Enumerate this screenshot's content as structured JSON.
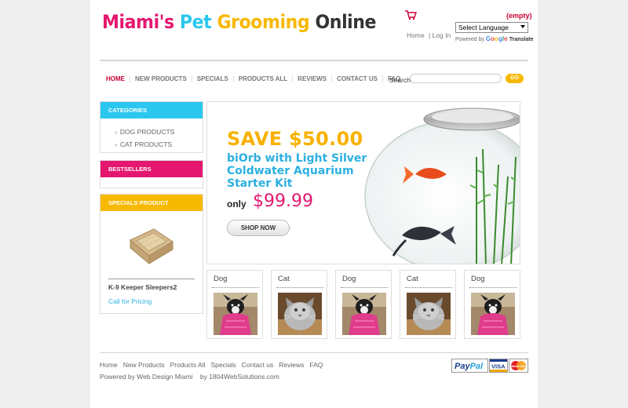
{
  "logo": {
    "parts": [
      {
        "text": "Miami's ",
        "color": "#e5176f"
      },
      {
        "text": "Pet ",
        "color": "#2bc7ee"
      },
      {
        "text": "Grooming ",
        "color": "#f7b800"
      },
      {
        "text": "Online",
        "color": "#333333"
      }
    ]
  },
  "header": {
    "cart_status": "(empty)",
    "language_select": "Select Language",
    "home_link": "Home",
    "login_link": "| Log In",
    "powered_by": "Powered by",
    "google": "Google",
    "translate": "Translate"
  },
  "nav": {
    "items": [
      "HOME",
      "NEW PRODUCTS",
      "SPECIALS",
      "PRODUCTS ALL",
      "REVIEWS",
      "CONTACT US",
      "FAQ"
    ],
    "search_label": "Search",
    "search_button": "GO"
  },
  "sidebar": {
    "categories_title": "CATEGORIES",
    "categories": [
      "DOG PRODUCTS",
      "CAT PRODUCTS"
    ],
    "bestsellers_title": "BESTSELLERS",
    "specials_title": "SPECIALS PRODUCT",
    "special_name": "K-9 Keeper Sleepers2",
    "special_price": "Call for Pricing"
  },
  "banner": {
    "save": "SAVE $50.00",
    "description": "biOrb with Light Silver Coldwater Aquarium Starter Kit",
    "only": "only",
    "price": "$99.99",
    "shop_now": "SHOP NOW"
  },
  "products": [
    {
      "label": "Dog",
      "kind": "dog"
    },
    {
      "label": "Cat",
      "kind": "cat"
    },
    {
      "label": "Dog",
      "kind": "dog"
    },
    {
      "label": "Cat",
      "kind": "cat"
    },
    {
      "label": "Dog",
      "kind": "dog"
    }
  ],
  "footer": {
    "links": [
      "Home",
      "New Products",
      "Products All",
      "Specials",
      "Contact us",
      "Reviews",
      "FAQ"
    ],
    "powered": "Powered by Web Design Miami",
    "by": "by 1804WebSolutions.com",
    "payment": [
      "PayPal",
      "VISA",
      "MasterCard"
    ]
  },
  "colors": {
    "pink": "#e5176f",
    "cyan": "#2bc7ee",
    "yellow": "#f7b800",
    "red": "#cc0033"
  }
}
